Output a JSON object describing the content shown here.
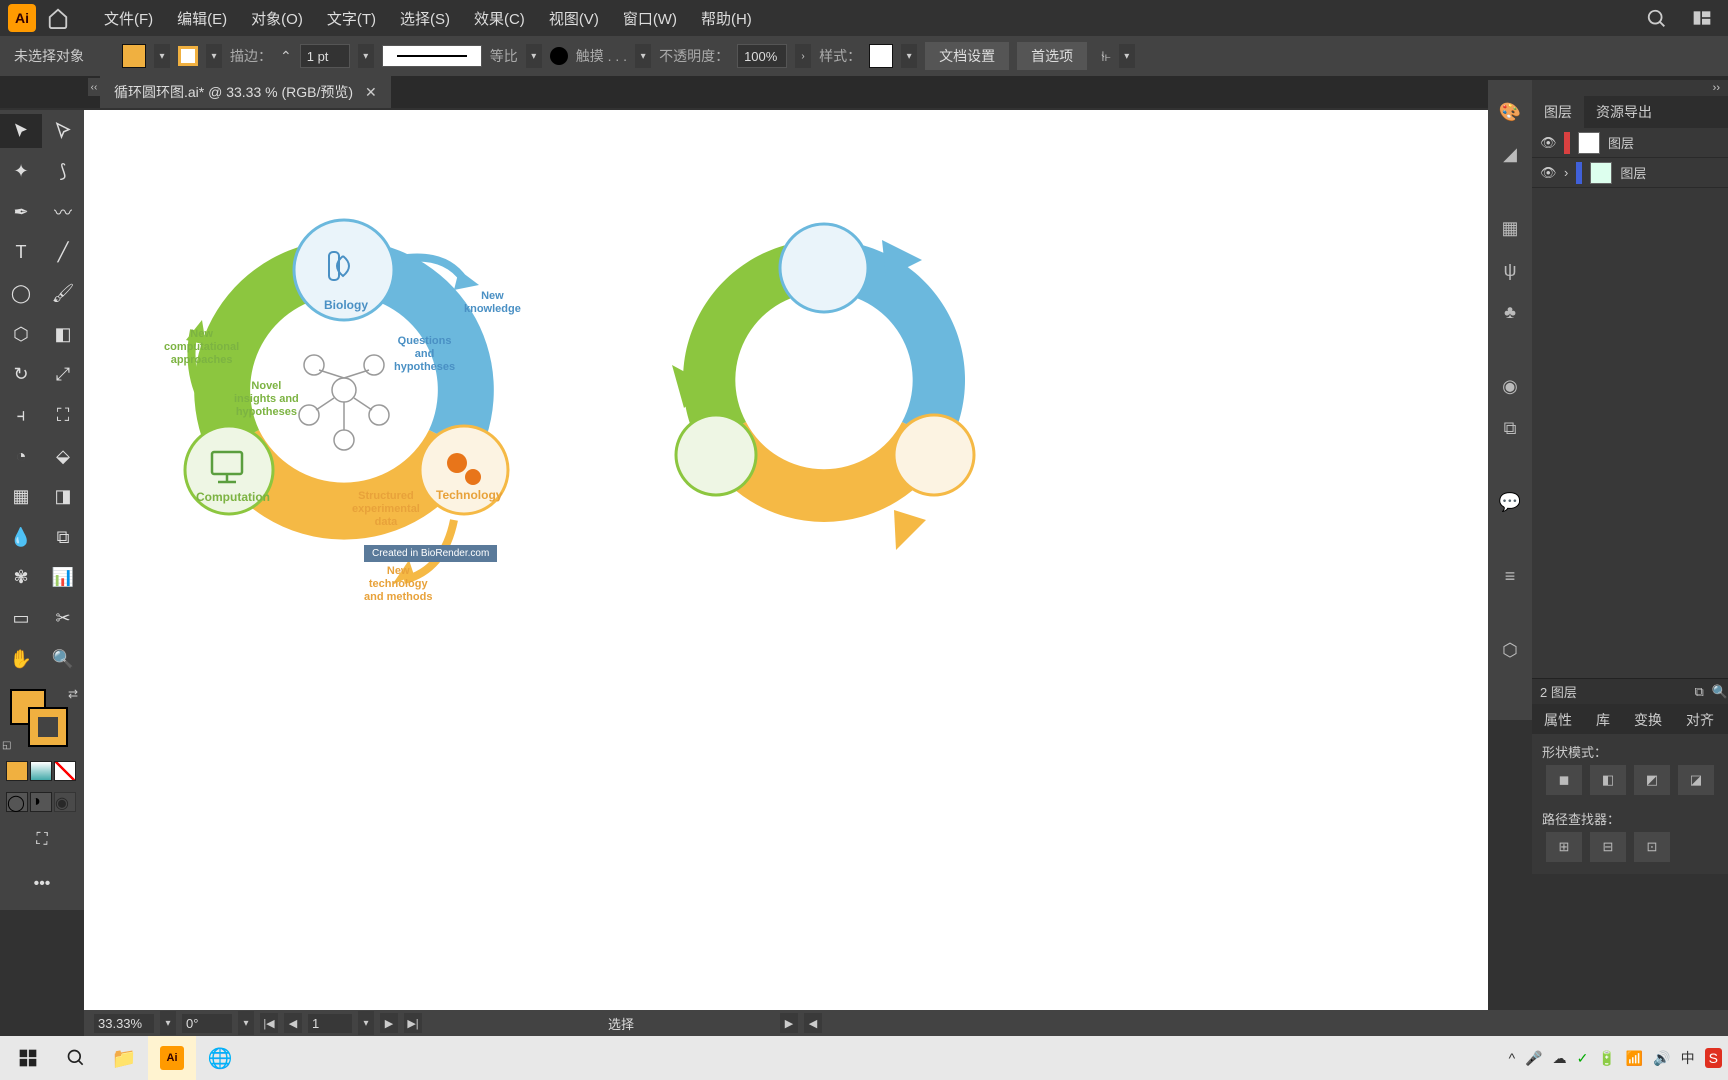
{
  "menubar": {
    "items": [
      "文件(F)",
      "编辑(E)",
      "对象(O)",
      "文字(T)",
      "选择(S)",
      "效果(C)",
      "视图(V)",
      "窗口(W)",
      "帮助(H)"
    ]
  },
  "controlbar": {
    "no_selection": "未选择对象",
    "stroke_label": "描边：",
    "stroke_weight": "1 pt",
    "stroke_style": "等比",
    "brush_label": "触摸 . . .",
    "opacity_label": "不透明度：",
    "opacity_value": "100%",
    "style_label": "样式：",
    "doc_setup": "文档设置",
    "prefs": "首选项"
  },
  "document": {
    "tab_title": "循环圆环图.ai* @ 33.33 % (RGB/预览)"
  },
  "statusbar": {
    "zoom": "33.33%",
    "rotation": "0°",
    "artboard": "1",
    "tool_mode": "选择"
  },
  "layers_panel": {
    "tab_layers": "图层",
    "tab_assets": "资源导出",
    "layers": [
      {
        "name": "图层",
        "color": "#d94040"
      },
      {
        "name": "图层",
        "color": "#4060d9"
      }
    ],
    "footer": "2 图层"
  },
  "properties_panel": {
    "tabs": [
      "属性",
      "库",
      "变换",
      "对齐"
    ],
    "shape_mode_label": "形状模式：",
    "pathfinder_label": "路径查找器："
  },
  "diagram": {
    "biology": "Biology",
    "technology": "Technology",
    "computation": "Computation",
    "new_knowledge": "New\nknowledge",
    "questions": "Questions\nand\nhypotheses",
    "structured_data": "Structured\nexperimental\ndata",
    "new_technology": "New\ntechnology\nand methods",
    "novel_insights": "Novel\ninsights and\nhypotheses",
    "new_computational": "New\ncomputational\napproaches",
    "biorender": "Created in BioRender.com"
  },
  "colors": {
    "blue": "#6bb8dd",
    "green": "#8cc63f",
    "orange": "#f5b945",
    "fill": "#f0b040"
  }
}
